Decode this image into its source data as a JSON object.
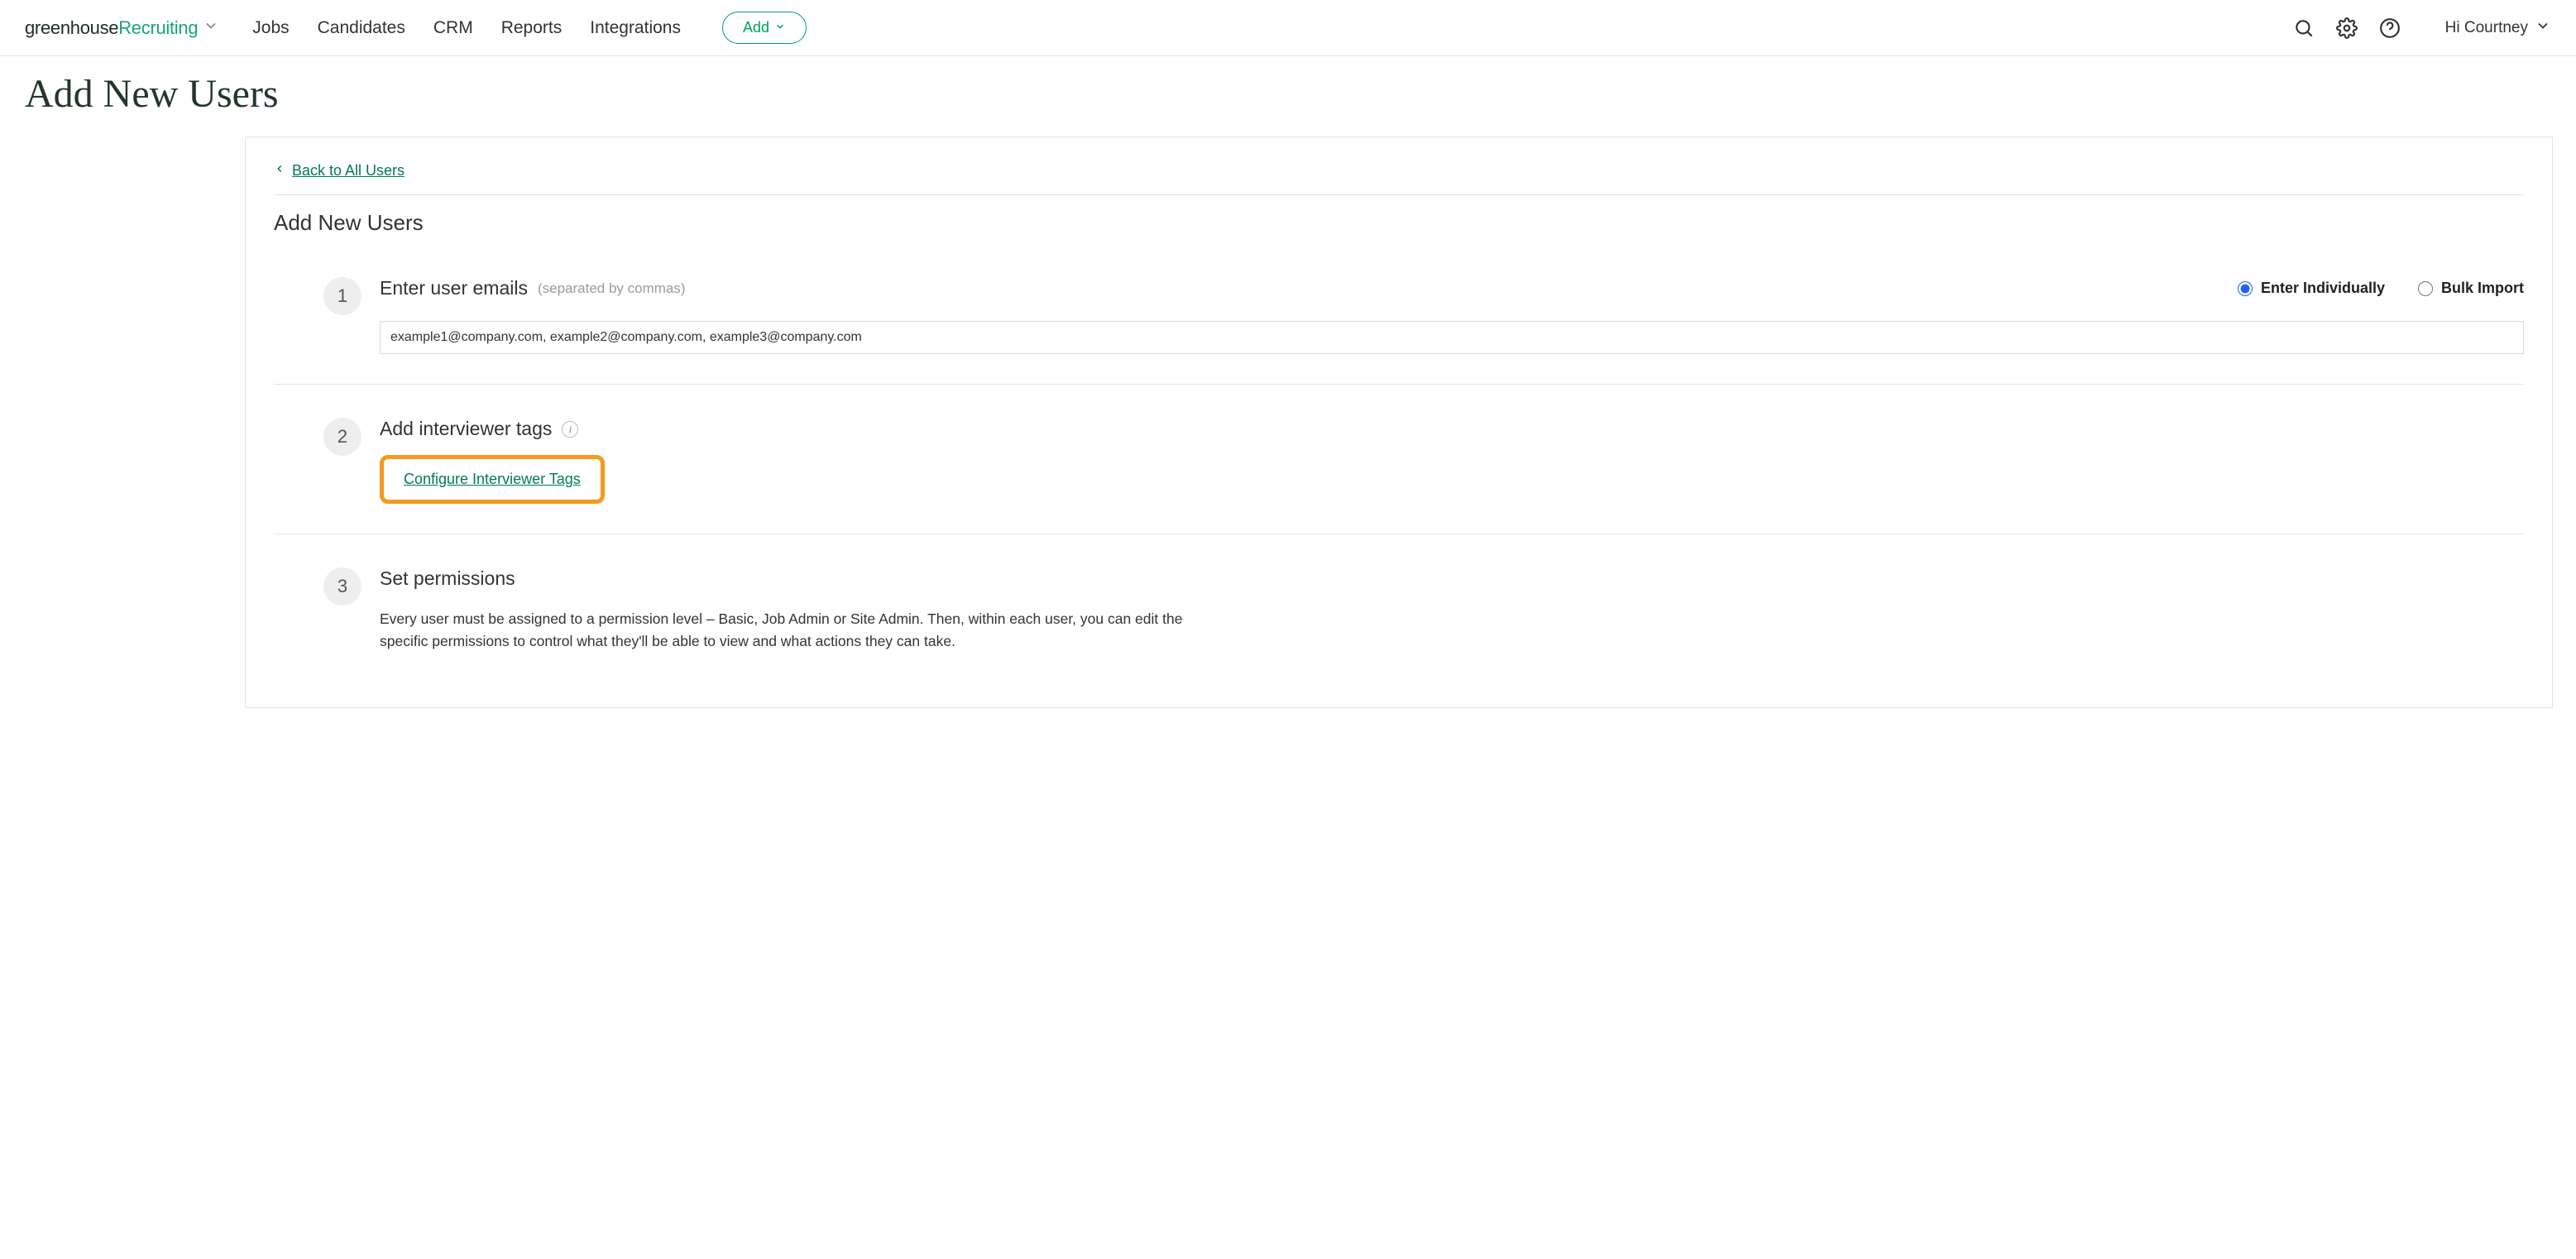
{
  "header": {
    "logo_part1": "greenhouse",
    "logo_part2": " Recruiting",
    "nav": [
      "Jobs",
      "Candidates",
      "CRM",
      "Reports",
      "Integrations"
    ],
    "add_button": "Add",
    "greeting": "Hi Courtney"
  },
  "page": {
    "title": "Add New Users"
  },
  "panel": {
    "back_link": "Back to All Users",
    "heading": "Add New Users",
    "steps": {
      "s1": {
        "num": "1",
        "title": "Enter user emails",
        "hint": "(separated by commas)",
        "radio_individual": "Enter Individually",
        "radio_bulk": "Bulk Import",
        "emails_value": "example1@company.com, example2@company.com, example3@company.com"
      },
      "s2": {
        "num": "2",
        "title": "Add interviewer tags",
        "configure_link": "Configure Interviewer Tags"
      },
      "s3": {
        "num": "3",
        "title": "Set permissions",
        "desc": "Every user must be assigned to a permission level – Basic, Job Admin or Site Admin. Then, within each user, you can edit the specific permissions to control what they'll be able to view and what actions they can take."
      }
    }
  }
}
